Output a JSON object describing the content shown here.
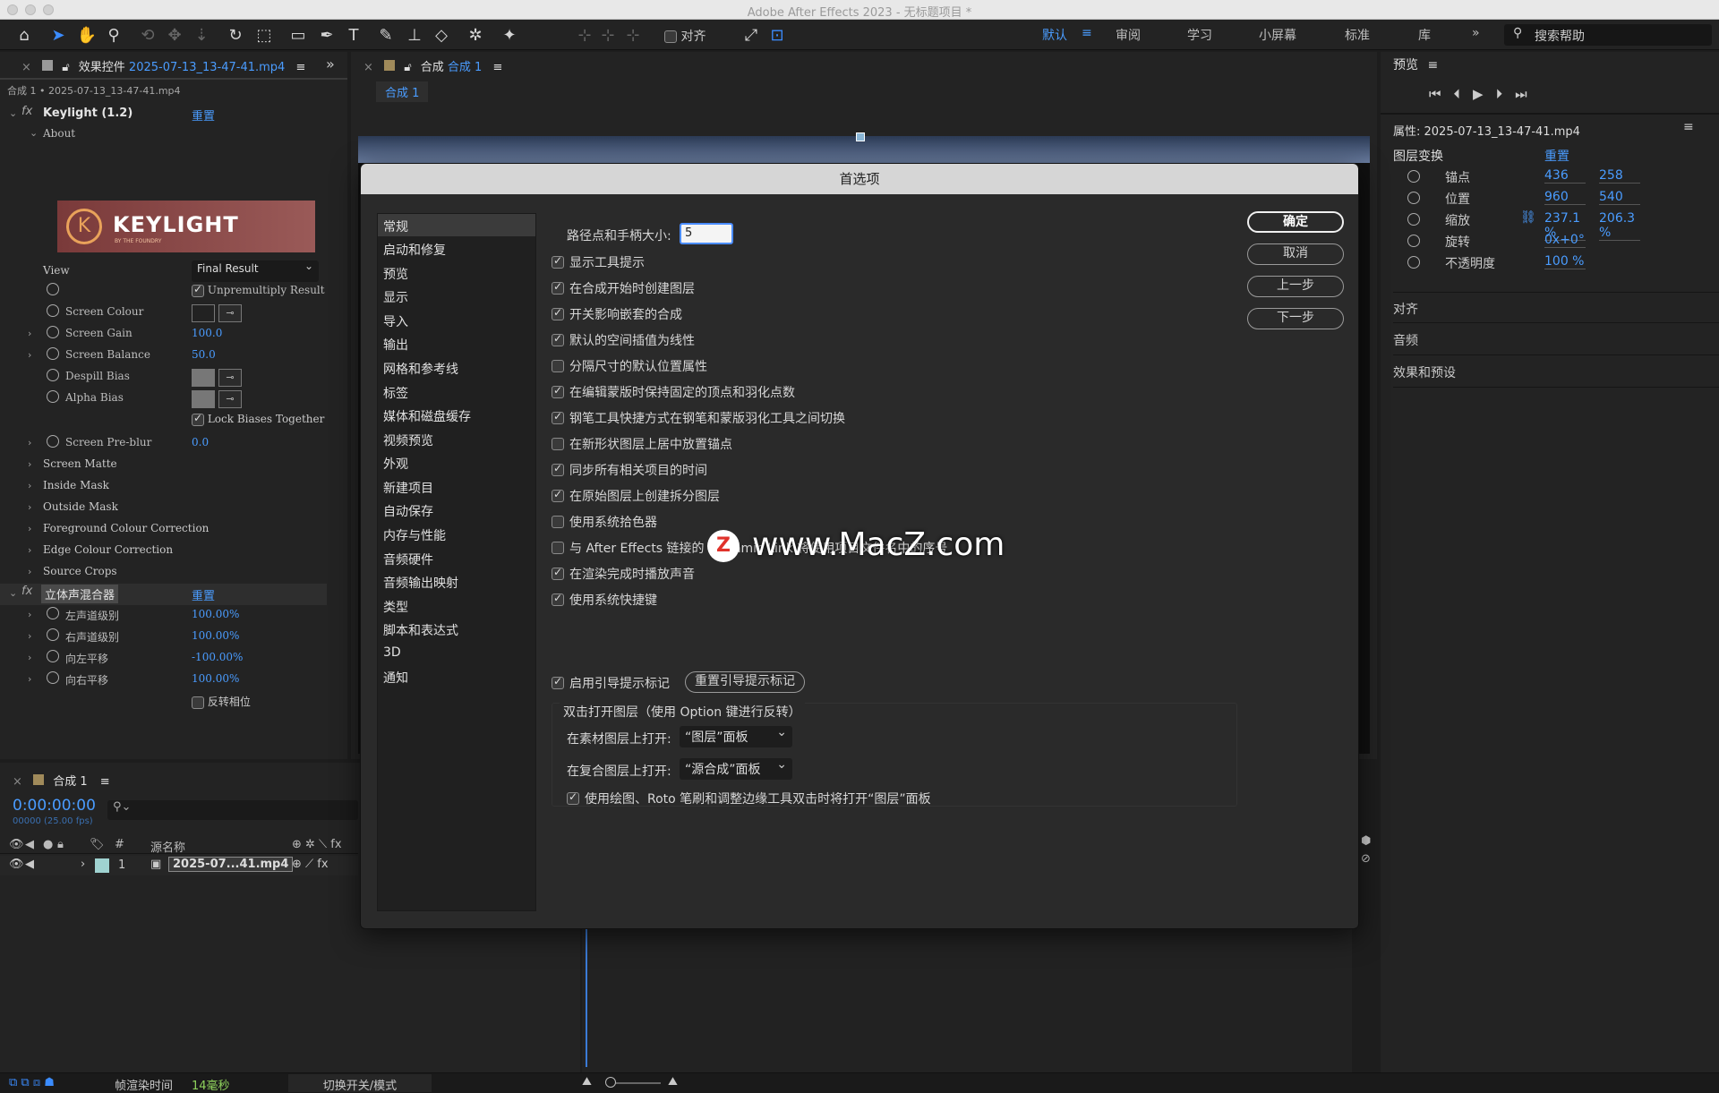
{
  "window": {
    "title": "Adobe After Effects 2023 - 无标题项目 *"
  },
  "toolbar": {
    "align_label": "对齐",
    "workspaces": [
      "默认",
      "审阅",
      "学习",
      "小屏幕",
      "标准",
      "库"
    ],
    "search_placeholder": "搜索帮助"
  },
  "effects_panel": {
    "tab_label": "效果控件",
    "tab_file": "2025-07-13_13-47-41.mp4",
    "breadcrumb": "合成 1 • 2025-07-13_13-47-41.mp4",
    "keylight": {
      "name": "Keylight (1.2)",
      "reset": "重置",
      "about": "About",
      "logo_text": "KEYLIGHT",
      "logo_sub": "BY THE FOUNDRY",
      "view_label": "View",
      "view_value": "Final Result",
      "unpremultiply": "Unpremultiply Result",
      "screen_colour": "Screen Colour",
      "screen_gain": "Screen Gain",
      "screen_gain_val": "100.0",
      "screen_balance": "Screen Balance",
      "screen_balance_val": "50.0",
      "despill_bias": "Despill Bias",
      "alpha_bias": "Alpha Bias",
      "lock_biases": "Lock Biases Together",
      "screen_preblur": "Screen Pre-blur",
      "screen_preblur_val": "0.0",
      "groups": [
        "Screen Matte",
        "Inside Mask",
        "Outside Mask",
        "Foreground Colour Correction",
        "Edge Colour Correction",
        "Source Crops"
      ]
    },
    "stereo": {
      "name": "立体声混合器",
      "reset": "重置",
      "params": [
        {
          "label": "左声道级别",
          "value": "100.00%"
        },
        {
          "label": "右声道级别",
          "value": "100.00%"
        },
        {
          "label": "向左平移",
          "value": "-100.00%"
        },
        {
          "label": "向右平移",
          "value": "100.00%"
        }
      ],
      "invert": "反转相位"
    }
  },
  "comp_panel": {
    "tab_prefix": "合成",
    "tab_name": "合成 1",
    "subtab": "合成 1"
  },
  "timeline": {
    "tab": "合成 1",
    "timecode": "0:00:00:00",
    "frames": "00000 (25.00 fps)",
    "col_hash": "#",
    "col_source": "源名称",
    "layer_num": "1",
    "layer_name": "2025-07...41.mp4",
    "render_time_label": "帧渲染时间",
    "render_time_value": "14毫秒",
    "switch_mode": "切换开关/模式"
  },
  "preview_panel": {
    "title": "预览"
  },
  "properties": {
    "title": "属性: 2025-07-13_13-47-41.mp4",
    "section": "图层变换",
    "reset": "重置",
    "rows": [
      {
        "label": "锚点",
        "v1": "436",
        "v2": "258"
      },
      {
        "label": "位置",
        "v1": "960",
        "v2": "540"
      },
      {
        "label": "缩放",
        "v1": "237.1 %",
        "v2": "206.3 %"
      },
      {
        "label": "旋转",
        "v1": "0x+0°",
        "v2": ""
      },
      {
        "label": "不透明度",
        "v1": "100 %",
        "v2": ""
      }
    ]
  },
  "right_sections": [
    "对齐",
    "音频",
    "效果和预设"
  ],
  "dialog": {
    "title": "首选项",
    "categories": [
      "常规",
      "启动和修复",
      "预览",
      "显示",
      "导入",
      "输出",
      "网格和参考线",
      "标签",
      "媒体和磁盘缓存",
      "视频预览",
      "外观",
      "新建项目",
      "自动保存",
      "内存与性能",
      "音频硬件",
      "音频输出映射",
      "类型",
      "脚本和表达式",
      "3D",
      "通知"
    ],
    "path_label": "路径点和手柄大小:",
    "path_value": "5",
    "options": [
      {
        "label": "显示工具提示",
        "checked": true
      },
      {
        "label": "在合成开始时创建图层",
        "checked": true
      },
      {
        "label": "开关影响嵌套的合成",
        "checked": true
      },
      {
        "label": "默认的空间插值为线性",
        "checked": true
      },
      {
        "label": "分隔尺寸的默认位置属性",
        "checked": false
      },
      {
        "label": "在编辑蒙版时保持固定的顶点和羽化点数",
        "checked": true
      },
      {
        "label": "钢笔工具快捷方式在钢笔和蒙版羽化工具之间切换",
        "checked": true
      },
      {
        "label": "在新形状图层上居中放置锚点",
        "checked": false
      },
      {
        "label": "同步所有相关项目的时间",
        "checked": true
      },
      {
        "label": "在原始图层上创建拆分图层",
        "checked": true
      },
      {
        "label": "使用系统拾色器",
        "checked": false
      },
      {
        "label": "与 After Effects 链接的 Dynamic Link 将使用项目文件名中的序号",
        "checked": false
      },
      {
        "label": "在渲染完成时播放声音",
        "checked": true
      },
      {
        "label": "使用系统快捷键",
        "checked": true
      }
    ],
    "enable_hints": "启用引导提示标记",
    "reset_hints": "重置引导提示标记",
    "group_title": "双击打开图层（使用 Option 键进行反转）",
    "footage_label": "在素材图层上打开:",
    "footage_value": "“图层”面板",
    "comp_label": "在复合图层上打开:",
    "comp_value": "“源合成”面板",
    "paint_option": "使用绘图、Roto 笔刷和调整边缘工具双击时将打开“图层”面板",
    "buttons": {
      "ok": "确定",
      "cancel": "取消",
      "prev": "上一步",
      "next": "下一步"
    }
  },
  "watermark": {
    "text": "www.MacZ.com",
    "badge": "Z"
  }
}
